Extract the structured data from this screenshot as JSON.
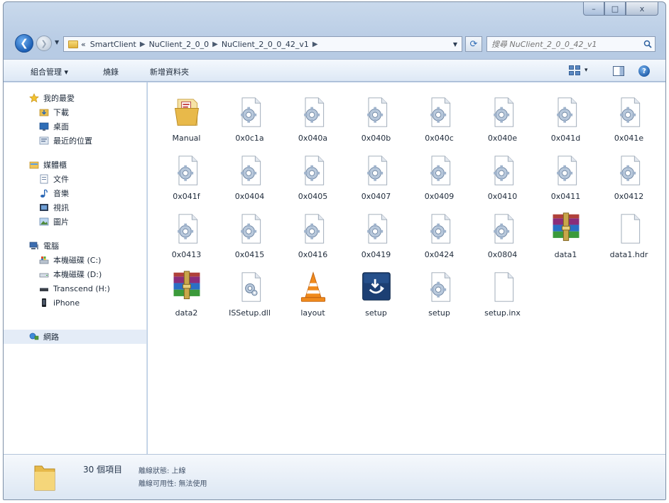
{
  "window": {
    "caption": {
      "minimize": "–",
      "maximize": "□",
      "close": "x"
    }
  },
  "navigation": {
    "back_glyph": "❮",
    "forward_glyph": "❯",
    "breadcrumb_overflow": "«",
    "breadcrumbs": [
      "SmartClient",
      "NuClient_2_0_0",
      "NuClient_2_0_0_42_v1"
    ],
    "refresh_glyph": "⟳",
    "search_placeholder": "搜尋 NuClient_2_0_0_42_v1"
  },
  "command_bar": {
    "organize": "組合管理 ▾",
    "burn": "燒錄",
    "new_folder": "新增資料夾",
    "view_dropdown": "▾",
    "help": "?"
  },
  "nav_pane": {
    "favorites": {
      "label": "我的最愛",
      "items": [
        "下載",
        "桌面",
        "最近的位置"
      ]
    },
    "libraries": {
      "label": "媒體櫃",
      "items": [
        "文件",
        "音樂",
        "視訊",
        "圖片"
      ]
    },
    "computer": {
      "label": "電腦",
      "items": [
        "本機磁碟 (C:)",
        "本機磁碟 (D:)",
        "Transcend (H:)",
        "iPhone"
      ]
    },
    "network": {
      "label": "網路"
    }
  },
  "files": [
    {
      "name": "Manual",
      "type": "folder"
    },
    {
      "name": "0x0c1a",
      "type": "ini"
    },
    {
      "name": "0x040a",
      "type": "ini"
    },
    {
      "name": "0x040b",
      "type": "ini"
    },
    {
      "name": "0x040c",
      "type": "ini"
    },
    {
      "name": "0x040e",
      "type": "ini"
    },
    {
      "name": "0x041d",
      "type": "ini"
    },
    {
      "name": "0x041e",
      "type": "ini"
    },
    {
      "name": "0x041f",
      "type": "ini"
    },
    {
      "name": "0x0404",
      "type": "ini"
    },
    {
      "name": "0x0405",
      "type": "ini"
    },
    {
      "name": "0x0407",
      "type": "ini"
    },
    {
      "name": "0x0409",
      "type": "ini"
    },
    {
      "name": "0x0410",
      "type": "ini"
    },
    {
      "name": "0x0411",
      "type": "ini"
    },
    {
      "name": "0x0412",
      "type": "ini"
    },
    {
      "name": "0x0413",
      "type": "ini"
    },
    {
      "name": "0x0415",
      "type": "ini"
    },
    {
      "name": "0x0416",
      "type": "ini"
    },
    {
      "name": "0x0419",
      "type": "ini"
    },
    {
      "name": "0x0424",
      "type": "ini"
    },
    {
      "name": "0x0804",
      "type": "ini"
    },
    {
      "name": "data1",
      "type": "rar"
    },
    {
      "name": "data1.hdr",
      "type": "blank"
    },
    {
      "name": "data2",
      "type": "rar"
    },
    {
      "name": "ISSetup.dll",
      "type": "dll"
    },
    {
      "name": "layout",
      "type": "vlc"
    },
    {
      "name": "setup",
      "type": "setup-exe"
    },
    {
      "name": "setup",
      "type": "ini"
    },
    {
      "name": "setup.inx",
      "type": "blank"
    }
  ],
  "status_bar": {
    "item_count": "30 個項目",
    "offline_status": "離線狀態: 上線",
    "offline_availability": "離線可用性: 無法使用"
  }
}
